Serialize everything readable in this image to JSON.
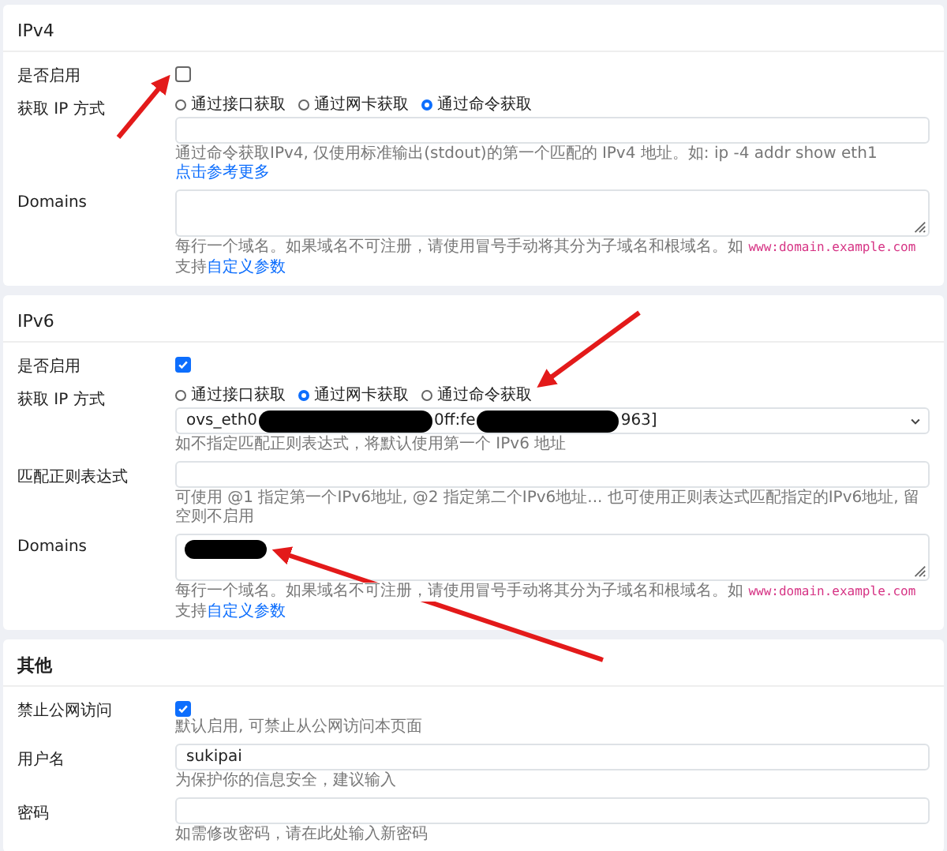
{
  "sections": [
    {
      "title": "IPv4",
      "bold": false,
      "fields": [
        {
          "kind": "checkbox",
          "label": "是否启用",
          "checked": false
        },
        {
          "kind": "radio",
          "label": "获取 IP 方式",
          "options": [
            {
              "label": "通过接口获取",
              "selected": false
            },
            {
              "label": "通过网卡获取",
              "selected": false
            },
            {
              "label": "通过命令获取",
              "selected": true
            }
          ],
          "control": {
            "kind": "input"
          },
          "hints": [
            [
              {
                "kind": "text",
                "text": "通过命令获取IPv4, 仅使用标准输出(stdout)的第一个匹配的 IPv4 地址。如: ip -4 addr show eth1 "
              },
              {
                "kind": "link",
                "text": "点击参考更多"
              }
            ]
          ]
        },
        {
          "kind": "textarea",
          "label": "Domains",
          "redacted": false,
          "hints": [
            [
              {
                "kind": "text",
                "text": "每行一个域名。如果域名不可注册，请使用冒号手动将其分为子域名和根域名。如 "
              },
              {
                "kind": "code",
                "text": "www:domain.example.com"
              }
            ],
            [
              {
                "kind": "text",
                "text": "支持"
              },
              {
                "kind": "link",
                "text": "自定义参数"
              }
            ]
          ]
        }
      ]
    },
    {
      "title": "IPv6",
      "bold": false,
      "fields": [
        {
          "kind": "checkbox",
          "label": "是否启用",
          "checked": true
        },
        {
          "kind": "radio",
          "label": "获取 IP 方式",
          "options": [
            {
              "label": "通过接口获取",
              "selected": false
            },
            {
              "label": "通过网卡获取",
              "selected": true
            },
            {
              "label": "通过命令获取",
              "selected": false
            }
          ],
          "control": {
            "kind": "select",
            "value_parts": [
              "ovs_eth0",
              "0ff:fe",
              "963]"
            ]
          },
          "hints": [
            [
              {
                "kind": "text",
                "text": "如不指定匹配正则表达式，将默认使用第一个 IPv6 地址"
              }
            ]
          ]
        },
        {
          "kind": "input",
          "label": "匹配正则表达式",
          "hints": [
            [
              {
                "kind": "text",
                "text": "可使用 @1 指定第一个IPv6地址, @2 指定第二个IPv6地址... 也可使用正则表达式匹配指定的IPv6地址, 留空则不启用"
              }
            ]
          ]
        },
        {
          "kind": "textarea",
          "label": "Domains",
          "redacted": true,
          "hints": [
            [
              {
                "kind": "text",
                "text": "每行一个域名。如果域名不可注册，请使用冒号手动将其分为子域名和根域名。如 "
              },
              {
                "kind": "code",
                "text": "www:domain.example.com"
              }
            ],
            [
              {
                "kind": "text",
                "text": "支持"
              },
              {
                "kind": "link",
                "text": "自定义参数"
              }
            ]
          ]
        }
      ]
    },
    {
      "title": "其他",
      "bold": true,
      "fields": [
        {
          "kind": "checkbox",
          "label": "禁止公网访问",
          "checked": true,
          "hints": [
            [
              {
                "kind": "text",
                "text": "默认启用, 可禁止从公网访问本页面"
              }
            ]
          ]
        },
        {
          "kind": "input",
          "label": "用户名",
          "value": "sukipai",
          "hints": [
            [
              {
                "kind": "text",
                "text": "为保护你的信息安全，建议输入"
              }
            ]
          ]
        },
        {
          "kind": "input",
          "label": "密码",
          "hints": [
            [
              {
                "kind": "text",
                "text": "如需修改密码，请在此处输入新密码"
              }
            ]
          ]
        }
      ]
    }
  ]
}
